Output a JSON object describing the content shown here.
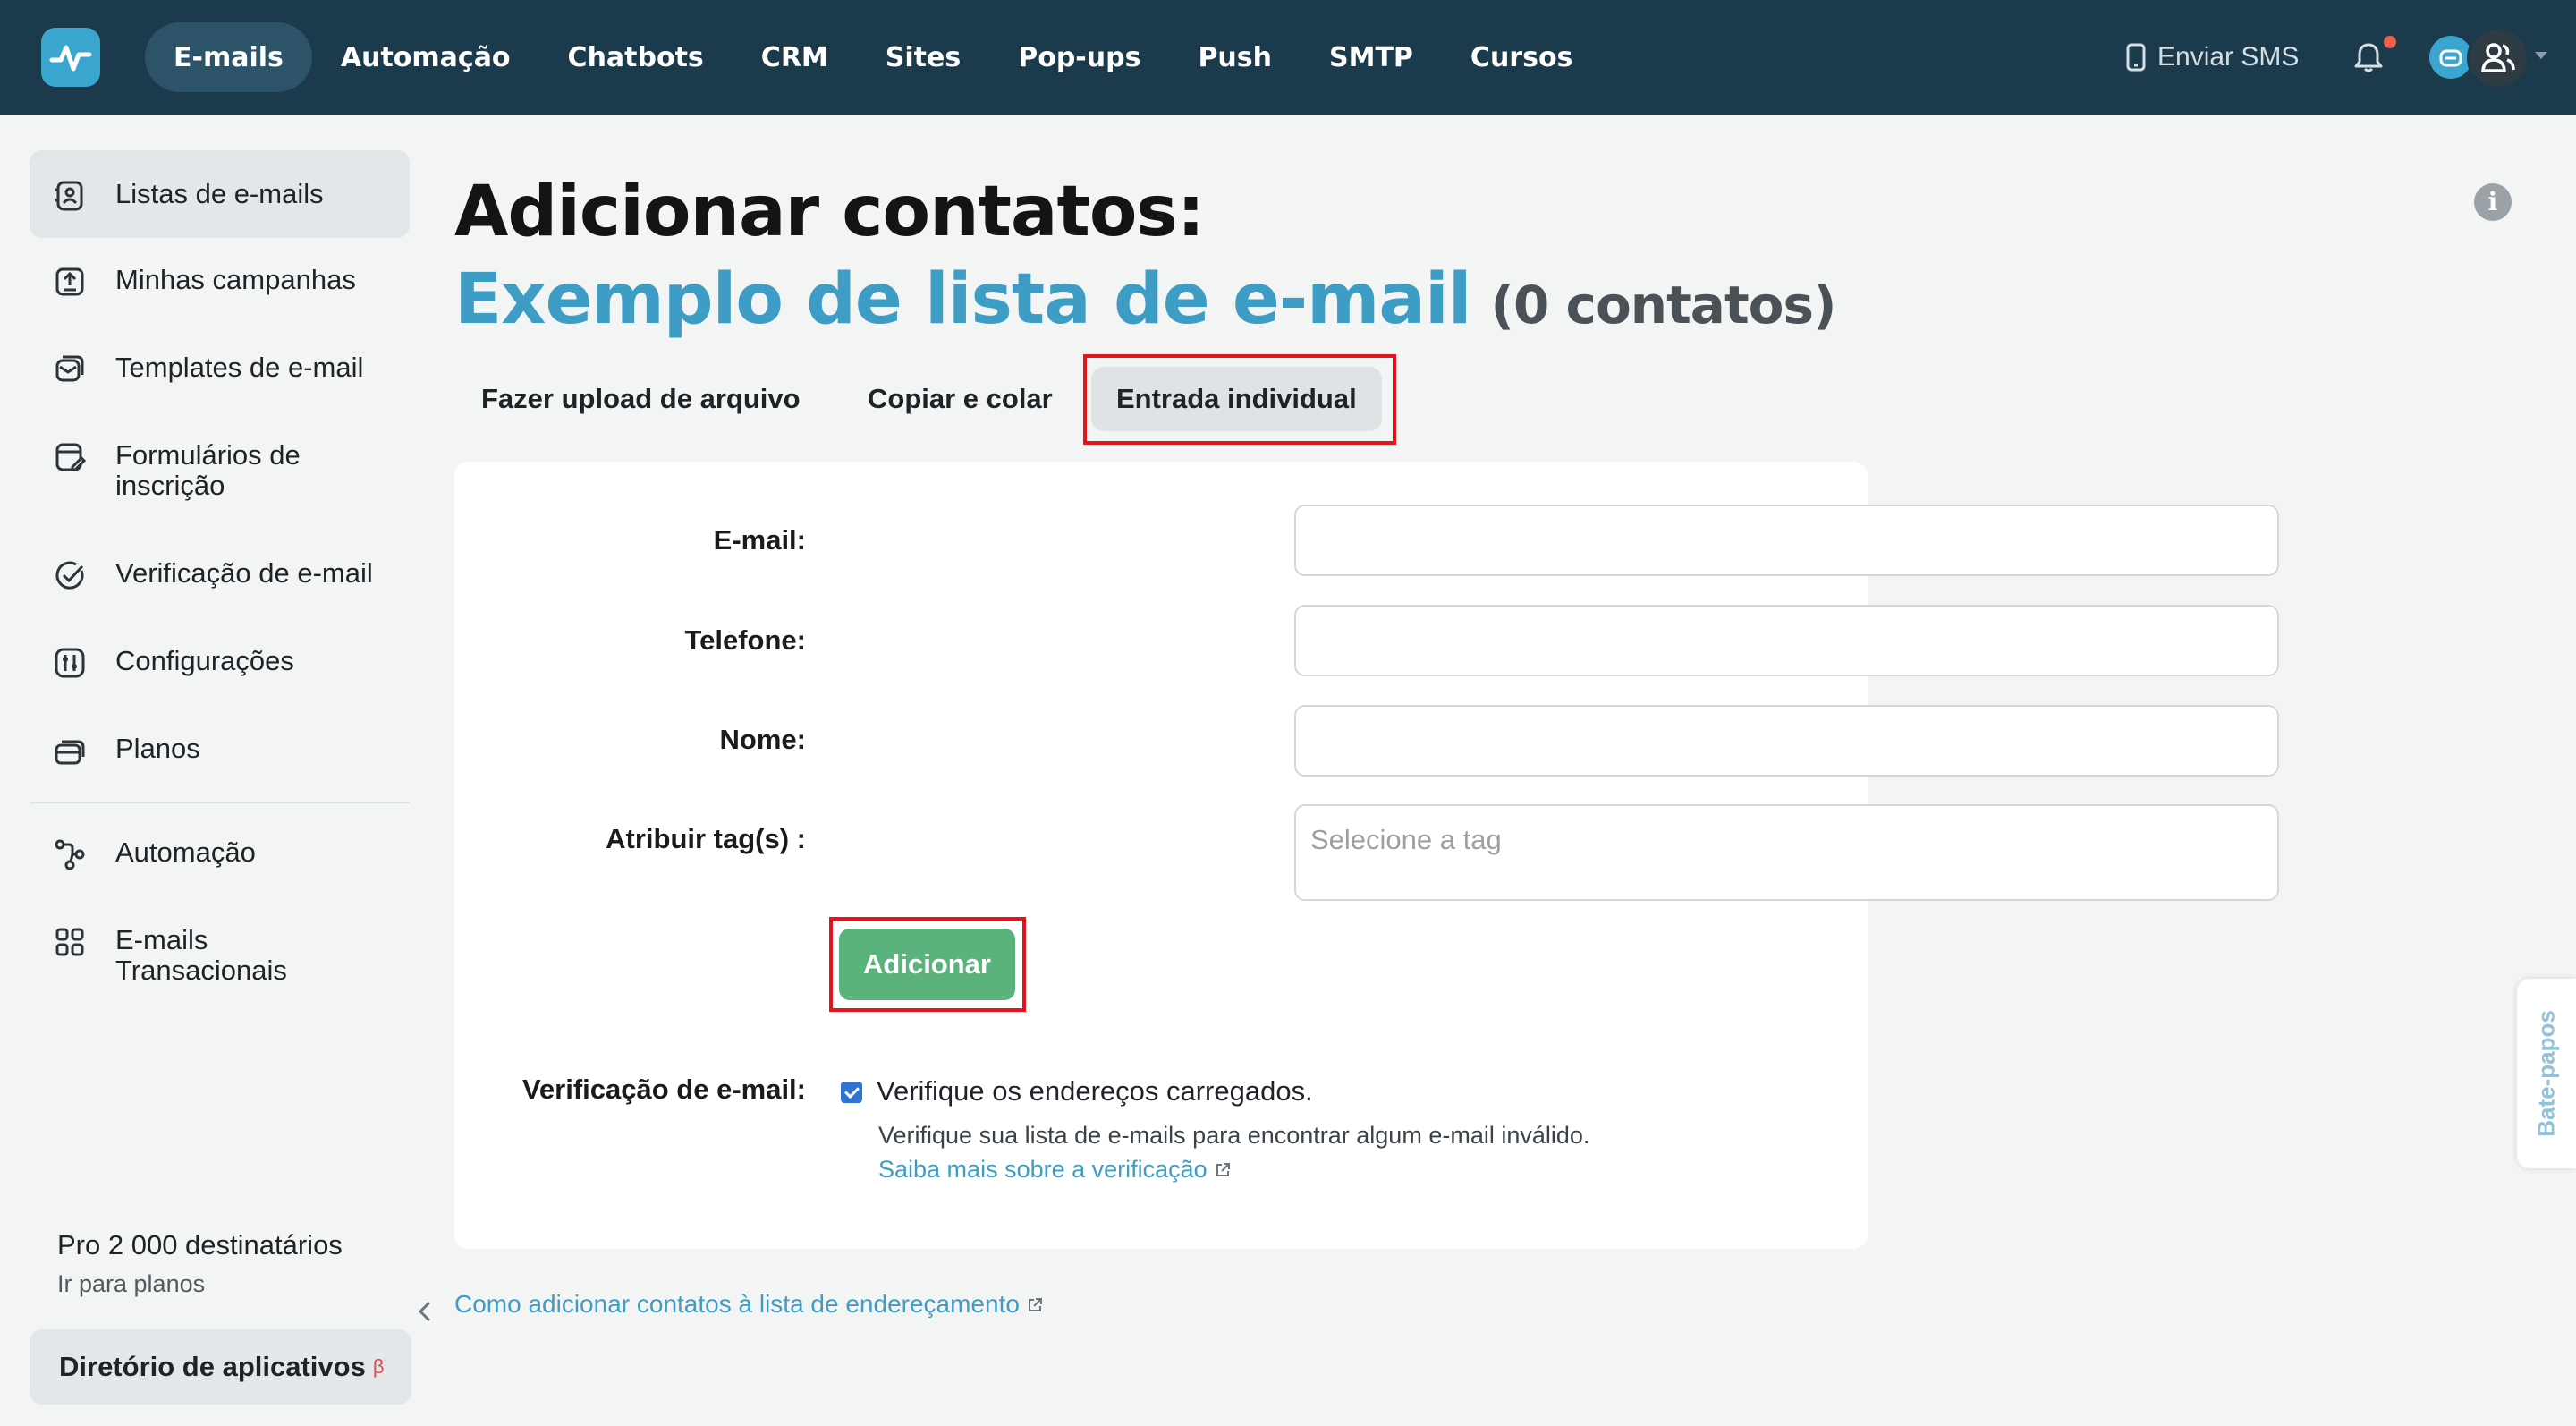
{
  "topbar": {
    "nav": [
      "E-mails",
      "Automação",
      "Chatbots",
      "CRM",
      "Sites",
      "Pop-ups",
      "Push",
      "SMTP",
      "Cursos"
    ],
    "active_nav": "E-mails",
    "sms_label": "Enviar SMS"
  },
  "sidebar": {
    "items": [
      {
        "label": "Listas de e-mails",
        "icon": "contacts-icon"
      },
      {
        "label": "Minhas campanhas",
        "icon": "campaign-upload-icon"
      },
      {
        "label": "Templates de e-mail",
        "icon": "template-icon"
      },
      {
        "label": "Formulários de inscrição",
        "icon": "form-icon"
      },
      {
        "label": "Verificação de e-mail",
        "icon": "verify-check-icon"
      },
      {
        "label": "Configurações",
        "icon": "settings-sliders-icon"
      },
      {
        "label": "Planos",
        "icon": "plans-cards-icon"
      },
      {
        "label": "Automação",
        "icon": "automation-flow-icon"
      },
      {
        "label": "E-mails Transacionais",
        "icon": "grid-icon"
      }
    ],
    "plan_title": "Pro 2 000 destinatários",
    "plan_link": "Ir para planos",
    "app_directory": "Diretório de aplicativos",
    "app_directory_badge": "β"
  },
  "main": {
    "title": "Adicionar contatos:",
    "list_name": "Exemplo de lista de e-mail",
    "list_count": "(0 contatos)",
    "tabs": [
      "Fazer upload de arquivo",
      "Copiar e colar",
      "Entrada individual"
    ],
    "active_tab": "Entrada individual",
    "form": {
      "email_label": "E-mail:",
      "email_value": "",
      "phone_label": "Telefone:",
      "phone_value": "",
      "name_label": "Nome:",
      "name_value": "",
      "tags_label": "Atribuir tag(s) :",
      "tags_placeholder": "Selecione a tag",
      "submit_label": "Adicionar"
    },
    "verification": {
      "label": "Verificação de e-mail:",
      "checkbox_label": "Verifique os endereços carregados.",
      "checked": true,
      "description": "Verifique sua lista de e-mails para encontrar algum e-mail inválido.",
      "learn_more": "Saiba mais sobre a verificação"
    },
    "help_link": "Como adicionar contatos à lista de endereçamento"
  },
  "chat_tab": "Bate-papos",
  "colors": {
    "topbar": "#1b3a4b",
    "accent_blue": "#3e9dc4",
    "button_green": "#5ab37a",
    "highlight_red": "#e3141b"
  }
}
